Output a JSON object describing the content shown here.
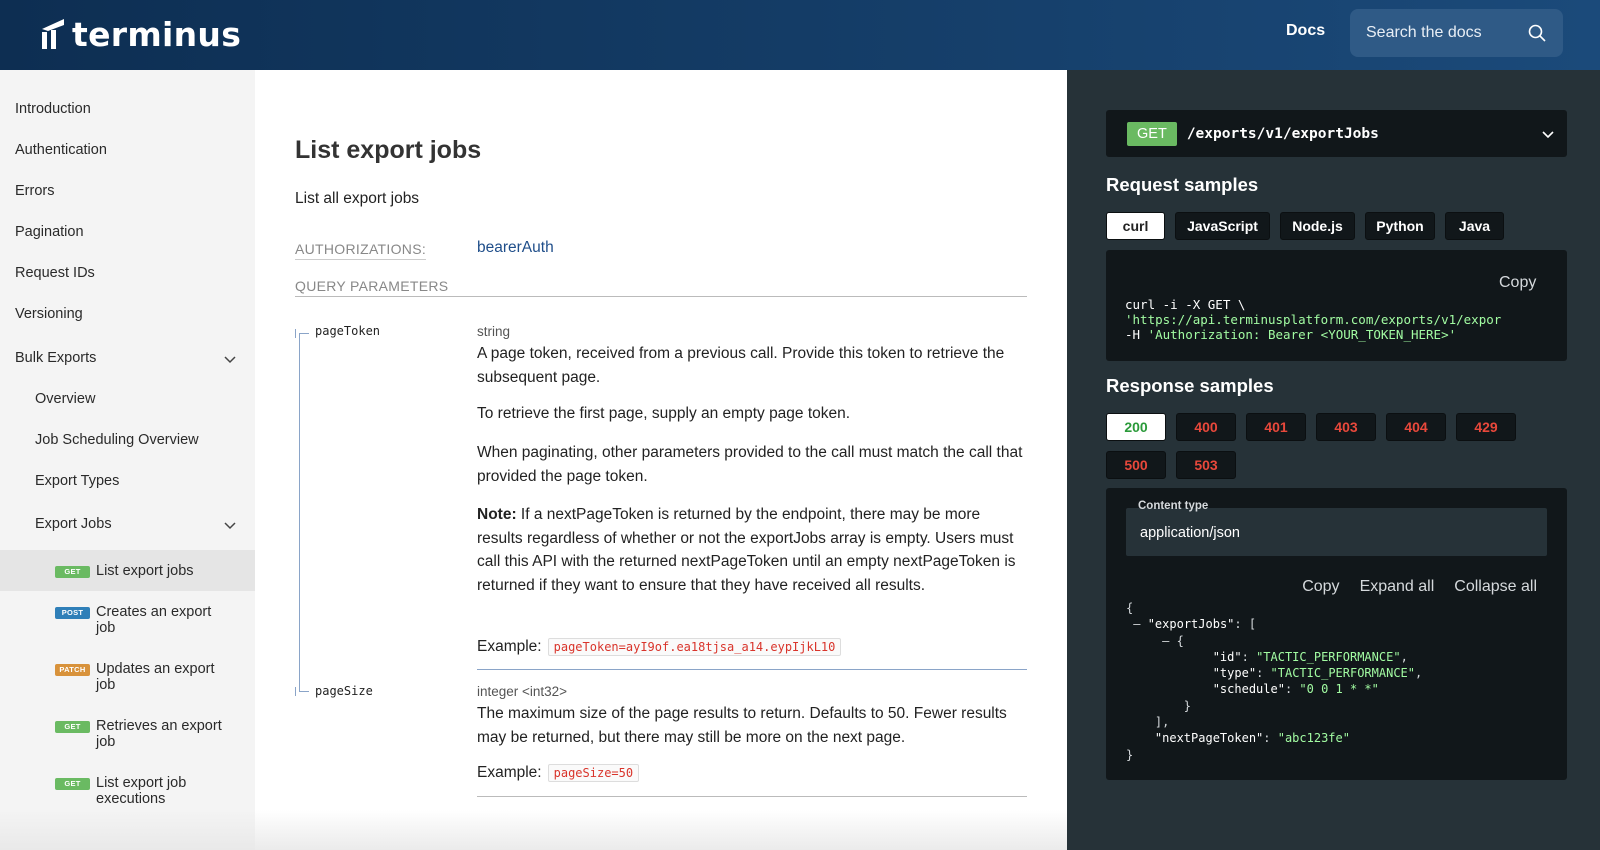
{
  "header": {
    "logo_text": "terminus",
    "docs_label": "Docs",
    "search_placeholder": "Search the docs"
  },
  "sidebar": {
    "items": [
      {
        "label": "Introduction"
      },
      {
        "label": "Authentication"
      },
      {
        "label": "Errors"
      },
      {
        "label": "Pagination"
      },
      {
        "label": "Request IDs"
      },
      {
        "label": "Versioning"
      },
      {
        "label": "Bulk Exports"
      }
    ],
    "bulk_children": [
      {
        "label": "Overview"
      },
      {
        "label": "Job Scheduling Overview"
      },
      {
        "label": "Export Types"
      },
      {
        "label": "Export Jobs"
      }
    ],
    "endpoints": [
      {
        "method": "GET",
        "label": "List export jobs"
      },
      {
        "method": "POST",
        "label": "Creates an export job"
      },
      {
        "method": "PATCH",
        "label": "Updates an export job"
      },
      {
        "method": "GET",
        "label": "Retrieves an export job"
      },
      {
        "method": "GET",
        "label": "List export job executions"
      }
    ]
  },
  "main": {
    "title": "List export jobs",
    "description": "List all export jobs",
    "auth_label": "AUTHORIZATIONS:",
    "auth_value": "bearerAuth",
    "query_label": "QUERY PARAMETERS",
    "params": [
      {
        "name": "pageToken",
        "type": "string",
        "p1": "A page token, received from a previous call. Provide this token to retrieve the subsequent page.",
        "p2": "To retrieve the first page, supply an empty page token.",
        "p3": "When paginating, other parameters provided to the call must match the call that provided the page token.",
        "note_label": "Note:",
        "note_text": " If a nextPageToken is returned by the endpoint, there may be more results regardless of whether or not the exportJobs array is empty. Users must call this API with the returned nextPageToken until an empty nextPageToken is returned if they want to ensure that they have received all results.",
        "example_label": "Example:",
        "example_value": "pageToken=ayI9of.ea18tjsa_a14.eypIjkL10"
      },
      {
        "name": "pageSize",
        "type": "integer <int32>",
        "p1": "The maximum size of the page results to return. Defaults to 50. Fewer results may be returned, but there may still be more on the next page.",
        "example_label": "Example:",
        "example_value": "pageSize=50"
      }
    ]
  },
  "right_panel": {
    "method": "GET",
    "path": "/exports/v1/exportJobs",
    "request_title": "Request samples",
    "request_tabs": [
      "curl",
      "JavaScript",
      "Node.js",
      "Python",
      "Java"
    ],
    "copy_label": "Copy",
    "curl_lines": [
      "curl -i -X GET \\",
      "'https://api.terminusplatform.com/exports/v1/expor",
      "-H 'Authorization: Bearer <YOUR_TOKEN_HERE>'"
    ],
    "response_title": "Response samples",
    "response_tabs": [
      "200",
      "400",
      "401",
      "403",
      "404",
      "429",
      "500",
      "503"
    ],
    "content_type_label": "Content type",
    "content_type_value": "application/json",
    "actions": [
      "Copy",
      "Expand all",
      "Collapse all"
    ],
    "json": {
      "k_exportJobs": "\"exportJobs\"",
      "k_id": "\"id\"",
      "v_id": "\"TACTIC_PERFORMANCE\"",
      "k_type": "\"type\"",
      "v_type": "\"TACTIC_PERFORMANCE\"",
      "k_schedule": "\"schedule\"",
      "v_schedule": "\"0 0 1 * *\"",
      "k_next": "\"nextPageToken\"",
      "v_next": "\"abc123fe\""
    }
  }
}
